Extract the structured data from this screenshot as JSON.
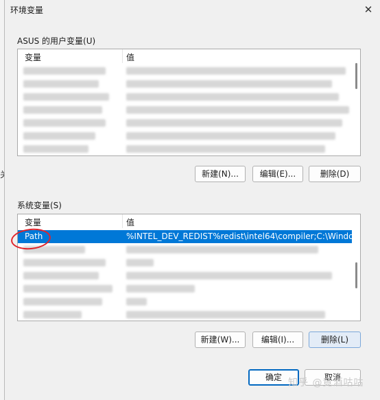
{
  "background_window": {
    "fragments": [
      "（",
      "关",
      "（"
    ]
  },
  "dialog": {
    "title": "环境变量"
  },
  "user_vars": {
    "group_label": "ASUS 的用户变量(U)",
    "col_variable": "变量",
    "col_value": "值",
    "buttons": {
      "new": "新建(N)...",
      "edit": "编辑(E)...",
      "delete": "删除(D)"
    }
  },
  "system_vars": {
    "group_label": "系统变量(S)",
    "col_variable": "变量",
    "col_value": "值",
    "selected_row": {
      "variable": "Path",
      "value": "%INTEL_DEV_REDIST%redist\\intel64\\compiler;C:\\Windows\\sy..."
    },
    "buttons": {
      "new": "新建(W)...",
      "edit": "编辑(I)...",
      "delete": "删除(L)"
    }
  },
  "footer": {
    "ok": "确定",
    "cancel": "取消"
  },
  "watermark": "知乎 @竟酒咕咕",
  "colors": {
    "selection": "#0078d7",
    "annotation": "#e0242b"
  }
}
